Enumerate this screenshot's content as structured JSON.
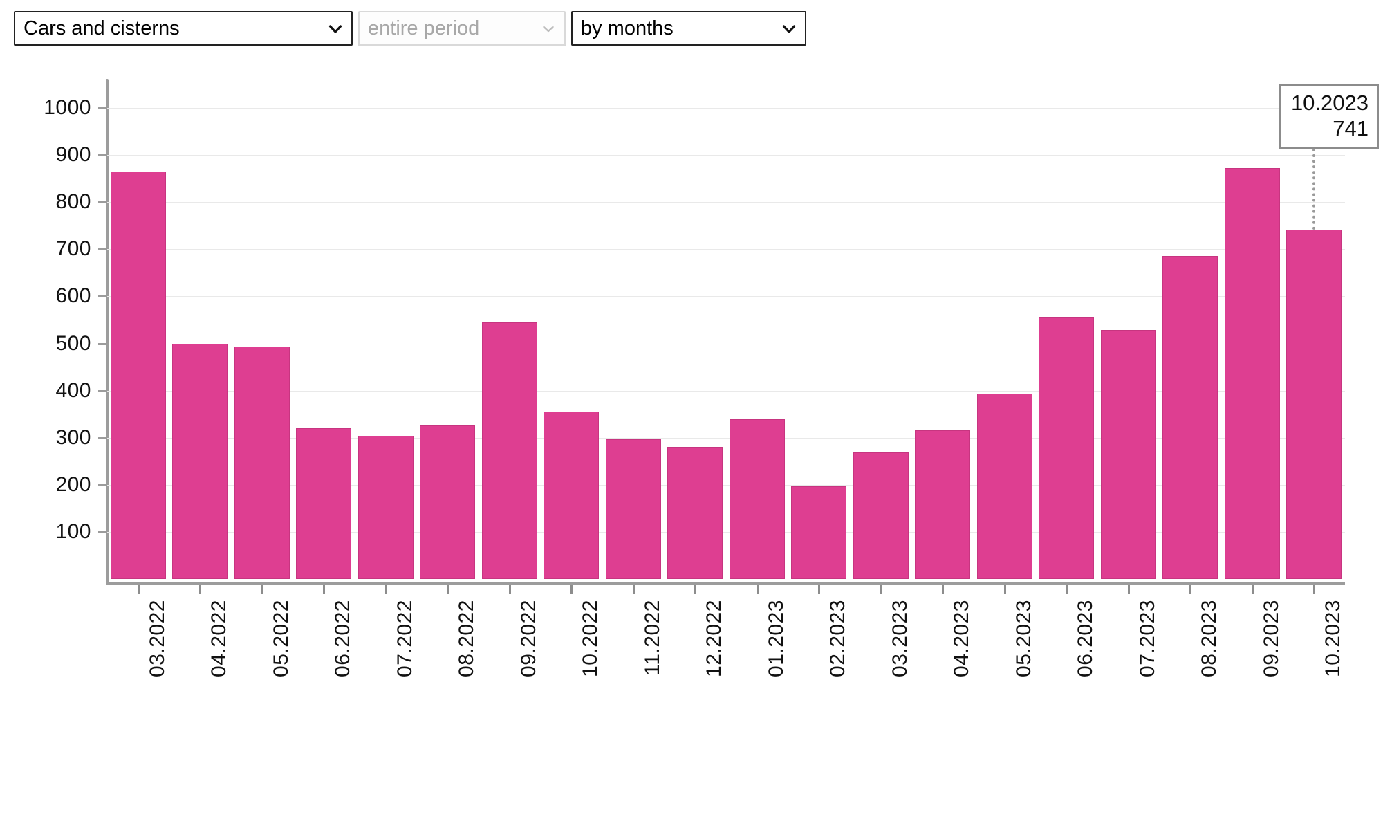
{
  "toolbar": {
    "category_select": {
      "value": "Cars and cisterns",
      "icon": "chevron-down-icon"
    },
    "period_select": {
      "value": "entire period",
      "icon": "chevron-down-icon",
      "disabled": true
    },
    "grouping_select": {
      "value": "by months",
      "icon": "chevron-down-icon"
    }
  },
  "tooltip": {
    "label": "10.2023",
    "value": "741"
  },
  "colors": {
    "bar": "#DE3E91",
    "bar_border": "#C73580",
    "grid": "#E9E9E9",
    "axis": "#9C9C9C",
    "tooltip_border": "#8C8C8C",
    "disabled_text": "#A8A8A8"
  },
  "chart_data": {
    "type": "bar",
    "title": "",
    "xlabel": "",
    "ylabel": "",
    "ylim": [
      0,
      1050
    ],
    "grid": true,
    "legend": "none",
    "yticks": [
      1000,
      900,
      800,
      700,
      600,
      500,
      400,
      300,
      200,
      100
    ],
    "categories": [
      "03.2022",
      "04.2022",
      "05.2022",
      "06.2022",
      "07.2022",
      "08.2022",
      "09.2022",
      "10.2022",
      "11.2022",
      "12.2022",
      "01.2023",
      "02.2023",
      "03.2023",
      "04.2023",
      "05.2023",
      "06.2023",
      "07.2023",
      "08.2023",
      "09.2023",
      "10.2023"
    ],
    "values": [
      865,
      500,
      493,
      320,
      304,
      326,
      545,
      356,
      297,
      281,
      339,
      197,
      269,
      316,
      393,
      556,
      529,
      686,
      872,
      741
    ],
    "highlighted_category": "10.2023",
    "highlighted_value": 741
  }
}
